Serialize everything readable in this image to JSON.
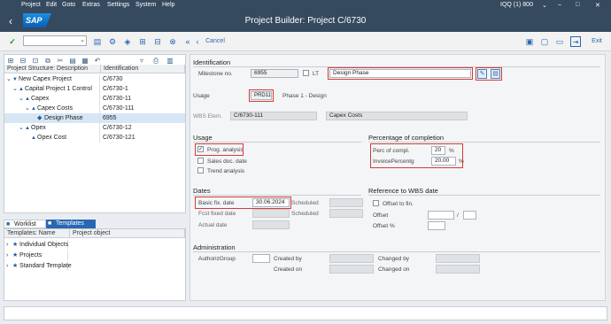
{
  "menu": [
    "Project",
    "Edit",
    "Goto",
    "Extras",
    "Settings",
    "System",
    "Help"
  ],
  "session": "IQQ (1) 800",
  "logo": "SAP",
  "title": "Project Builder: Project C/6730",
  "toolbar": {
    "cancel": "Cancel",
    "exit": "Exit"
  },
  "tree": {
    "headers": [
      "Project Structure: Description",
      "Identification"
    ],
    "rows": [
      {
        "desc": "New Capex Project",
        "id": "C/6730"
      },
      {
        "desc": "Capital Project 1 Control",
        "id": "C/6730-1"
      },
      {
        "desc": "Capex",
        "id": "C/6730-11"
      },
      {
        "desc": "Capex Costs",
        "id": "C/6730-111"
      },
      {
        "desc": "Design Phase",
        "id": "6955"
      },
      {
        "desc": "Opex",
        "id": "C/6730-12"
      },
      {
        "desc": "Opex Cost",
        "id": "C/6730-121"
      }
    ]
  },
  "tabs": {
    "worklist": "Worklist",
    "templates": "Templates"
  },
  "templates": {
    "headers": [
      "Templates: Name",
      "Project object"
    ],
    "items": [
      "Individual Objects",
      "Projects",
      "Standard Template"
    ]
  },
  "detail": {
    "identification": {
      "section": "Identification",
      "milestone_label": "Milestone no.",
      "milestone_no": "6955",
      "lt_label": "LT",
      "description": "Design Phase",
      "usage_label": "Usage",
      "usage_value": "PRD11",
      "usage_text": "Phase 1 - Design",
      "wbs_label": "WBS Elem.",
      "wbs_value": "C/6730-111",
      "wbs_text": "Capex Costs"
    },
    "usage": {
      "section": "Usage",
      "prog_analysis": "Prog. analysis",
      "sales_doc_date": "Sales doc. date",
      "trend_analysis": "Trend analysis"
    },
    "completion": {
      "section": "Percentage of completion",
      "perc_label": "Perc of compl.",
      "perc_value": "20",
      "invoice_label": "InvoicePercentg",
      "invoice_value": "20.00",
      "unit": "%"
    },
    "dates": {
      "section": "Dates",
      "basic_label": "Basic fix. date",
      "basic_value": "30.06.2024",
      "scheduled_label": "Scheduled",
      "fcst_label": "Fcst fixed date",
      "actual_label": "Actual date"
    },
    "wbs_ref": {
      "section": "Reference to WBS date",
      "offset_to_fin": "Offset to fin.",
      "offset_label": "Offset",
      "offset_pct_label": "Offset %",
      "slash": "/"
    },
    "admin": {
      "section": "Administration",
      "authoriz_label": "AuthorizGroup",
      "created_by": "Created by",
      "created_on": "Created on",
      "changed_by": "Changed by",
      "changed_on": "Changed on"
    }
  }
}
